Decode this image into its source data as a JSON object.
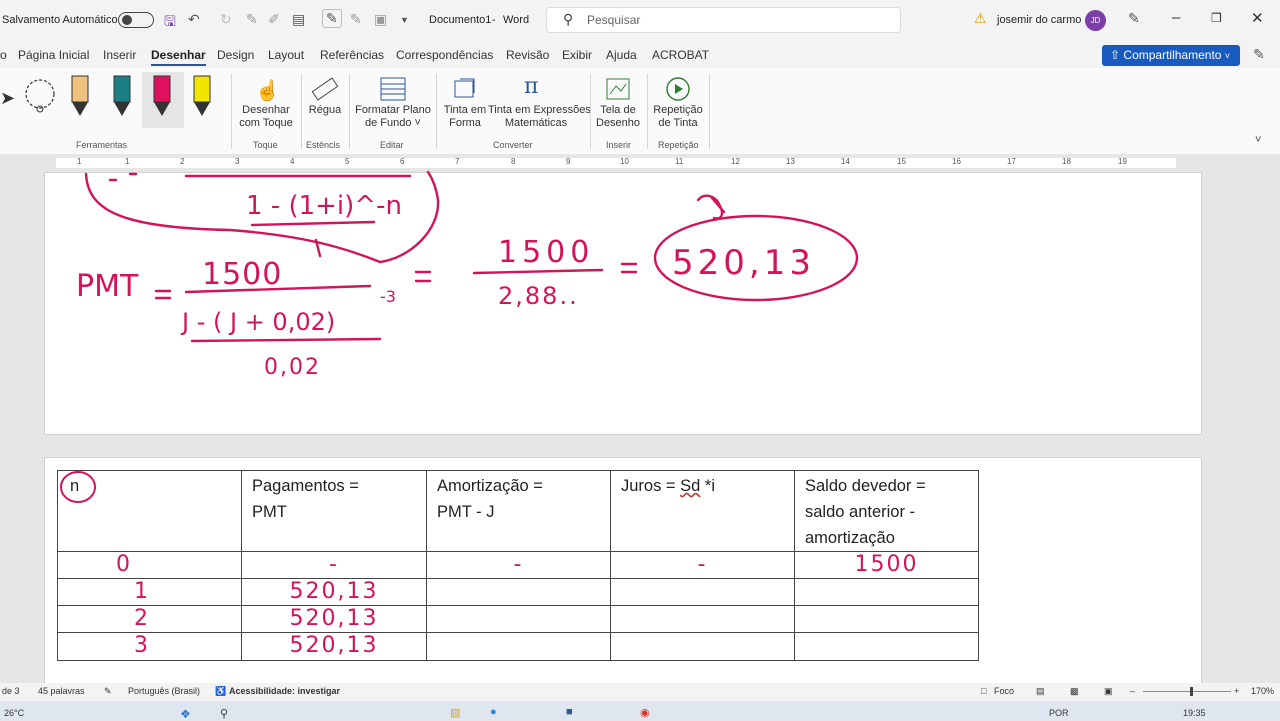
{
  "titlebar": {
    "autosave_label": "Salvamento Automático",
    "doc_title": "Documento1",
    "separator": "-",
    "app_name": "Word",
    "search_placeholder": "Pesquisar",
    "user_name": "josemir do carmo",
    "user_initials": "JD"
  },
  "menu": {
    "tabs": [
      "o",
      "Página Inicial",
      "Inserir",
      "Desenhar",
      "Design",
      "Layout",
      "Referências",
      "Correspondências",
      "Revisão",
      "Exibir",
      "Ajuda",
      "ACROBAT"
    ],
    "active_tab": "Desenhar",
    "share_label": "Compartilhamento"
  },
  "ribbon": {
    "groups": {
      "ferramentas": "Ferramentas",
      "toque": "Toque",
      "estencis": "Estêncis",
      "editar": "Editar",
      "converter": "Converter",
      "inserir": "Inserir",
      "repeticao": "Repetição"
    },
    "buttons": {
      "draw_touch": [
        "Desenhar",
        "com Toque"
      ],
      "ruler": "Régua",
      "background": [
        "Formatar Plano",
        "de Fundo ˅"
      ],
      "ink_shape": [
        "Tinta em",
        "Forma"
      ],
      "ink_math": [
        "Tinta em Expressões",
        "Matemáticas"
      ],
      "canvas": [
        "Tela de",
        "Desenho"
      ],
      "replay": [
        "Repetição",
        "de Tinta"
      ]
    },
    "pen_colors": [
      "#f1c27d",
      "#1b7f86",
      "#e0115f",
      "#f2e600"
    ]
  },
  "ruler_numbers": [
    "1",
    "1",
    "2",
    "3",
    "4",
    "5",
    "6",
    "7",
    "8",
    "9",
    "10",
    "11",
    "12",
    "13",
    "14",
    "15",
    "16",
    "17",
    "18",
    "19"
  ],
  "handwriting": {
    "pmt_formula": "PMT = 1500 / ((1 - (1 + 0,02)^-3) / 0,02)",
    "numerator": "1500",
    "rate": "0,02",
    "intermediate": "1500 / 2,88..",
    "result": "520,13",
    "top_partial": "1 - (1+i)^-n"
  },
  "table": {
    "headers": {
      "n": "n",
      "pmt_line1": "Pagamentos =",
      "pmt_line2": "PMT",
      "amort_line1": "Amortização =",
      "amort_line2": "PMT - J",
      "juros_prefix": "Juros = ",
      "juros_sd": "Sd",
      "juros_suffix": " *i",
      "saldo_line1": "Saldo devedor =",
      "saldo_line2": "saldo anterior -",
      "saldo_line3": "amortização"
    },
    "rows": [
      {
        "n": "0",
        "pmt": "-",
        "amort": "-",
        "juros": "-",
        "saldo": "1500"
      },
      {
        "n": "1",
        "pmt": "520,13",
        "amort": "",
        "juros": "",
        "saldo": ""
      },
      {
        "n": "2",
        "pmt": "520,13",
        "amort": "",
        "juros": "",
        "saldo": ""
      },
      {
        "n": "3",
        "pmt": "520,13",
        "amort": "",
        "juros": "",
        "saldo": ""
      }
    ]
  },
  "status": {
    "page": "de 3",
    "words": "45 palavras",
    "language": "Português (Brasil)",
    "accessibility": "Acessibilidade: investigar",
    "focus": "Foco",
    "zoom": "170%",
    "temperature": "26°C",
    "keyboard": "POR",
    "time": "19:35"
  }
}
